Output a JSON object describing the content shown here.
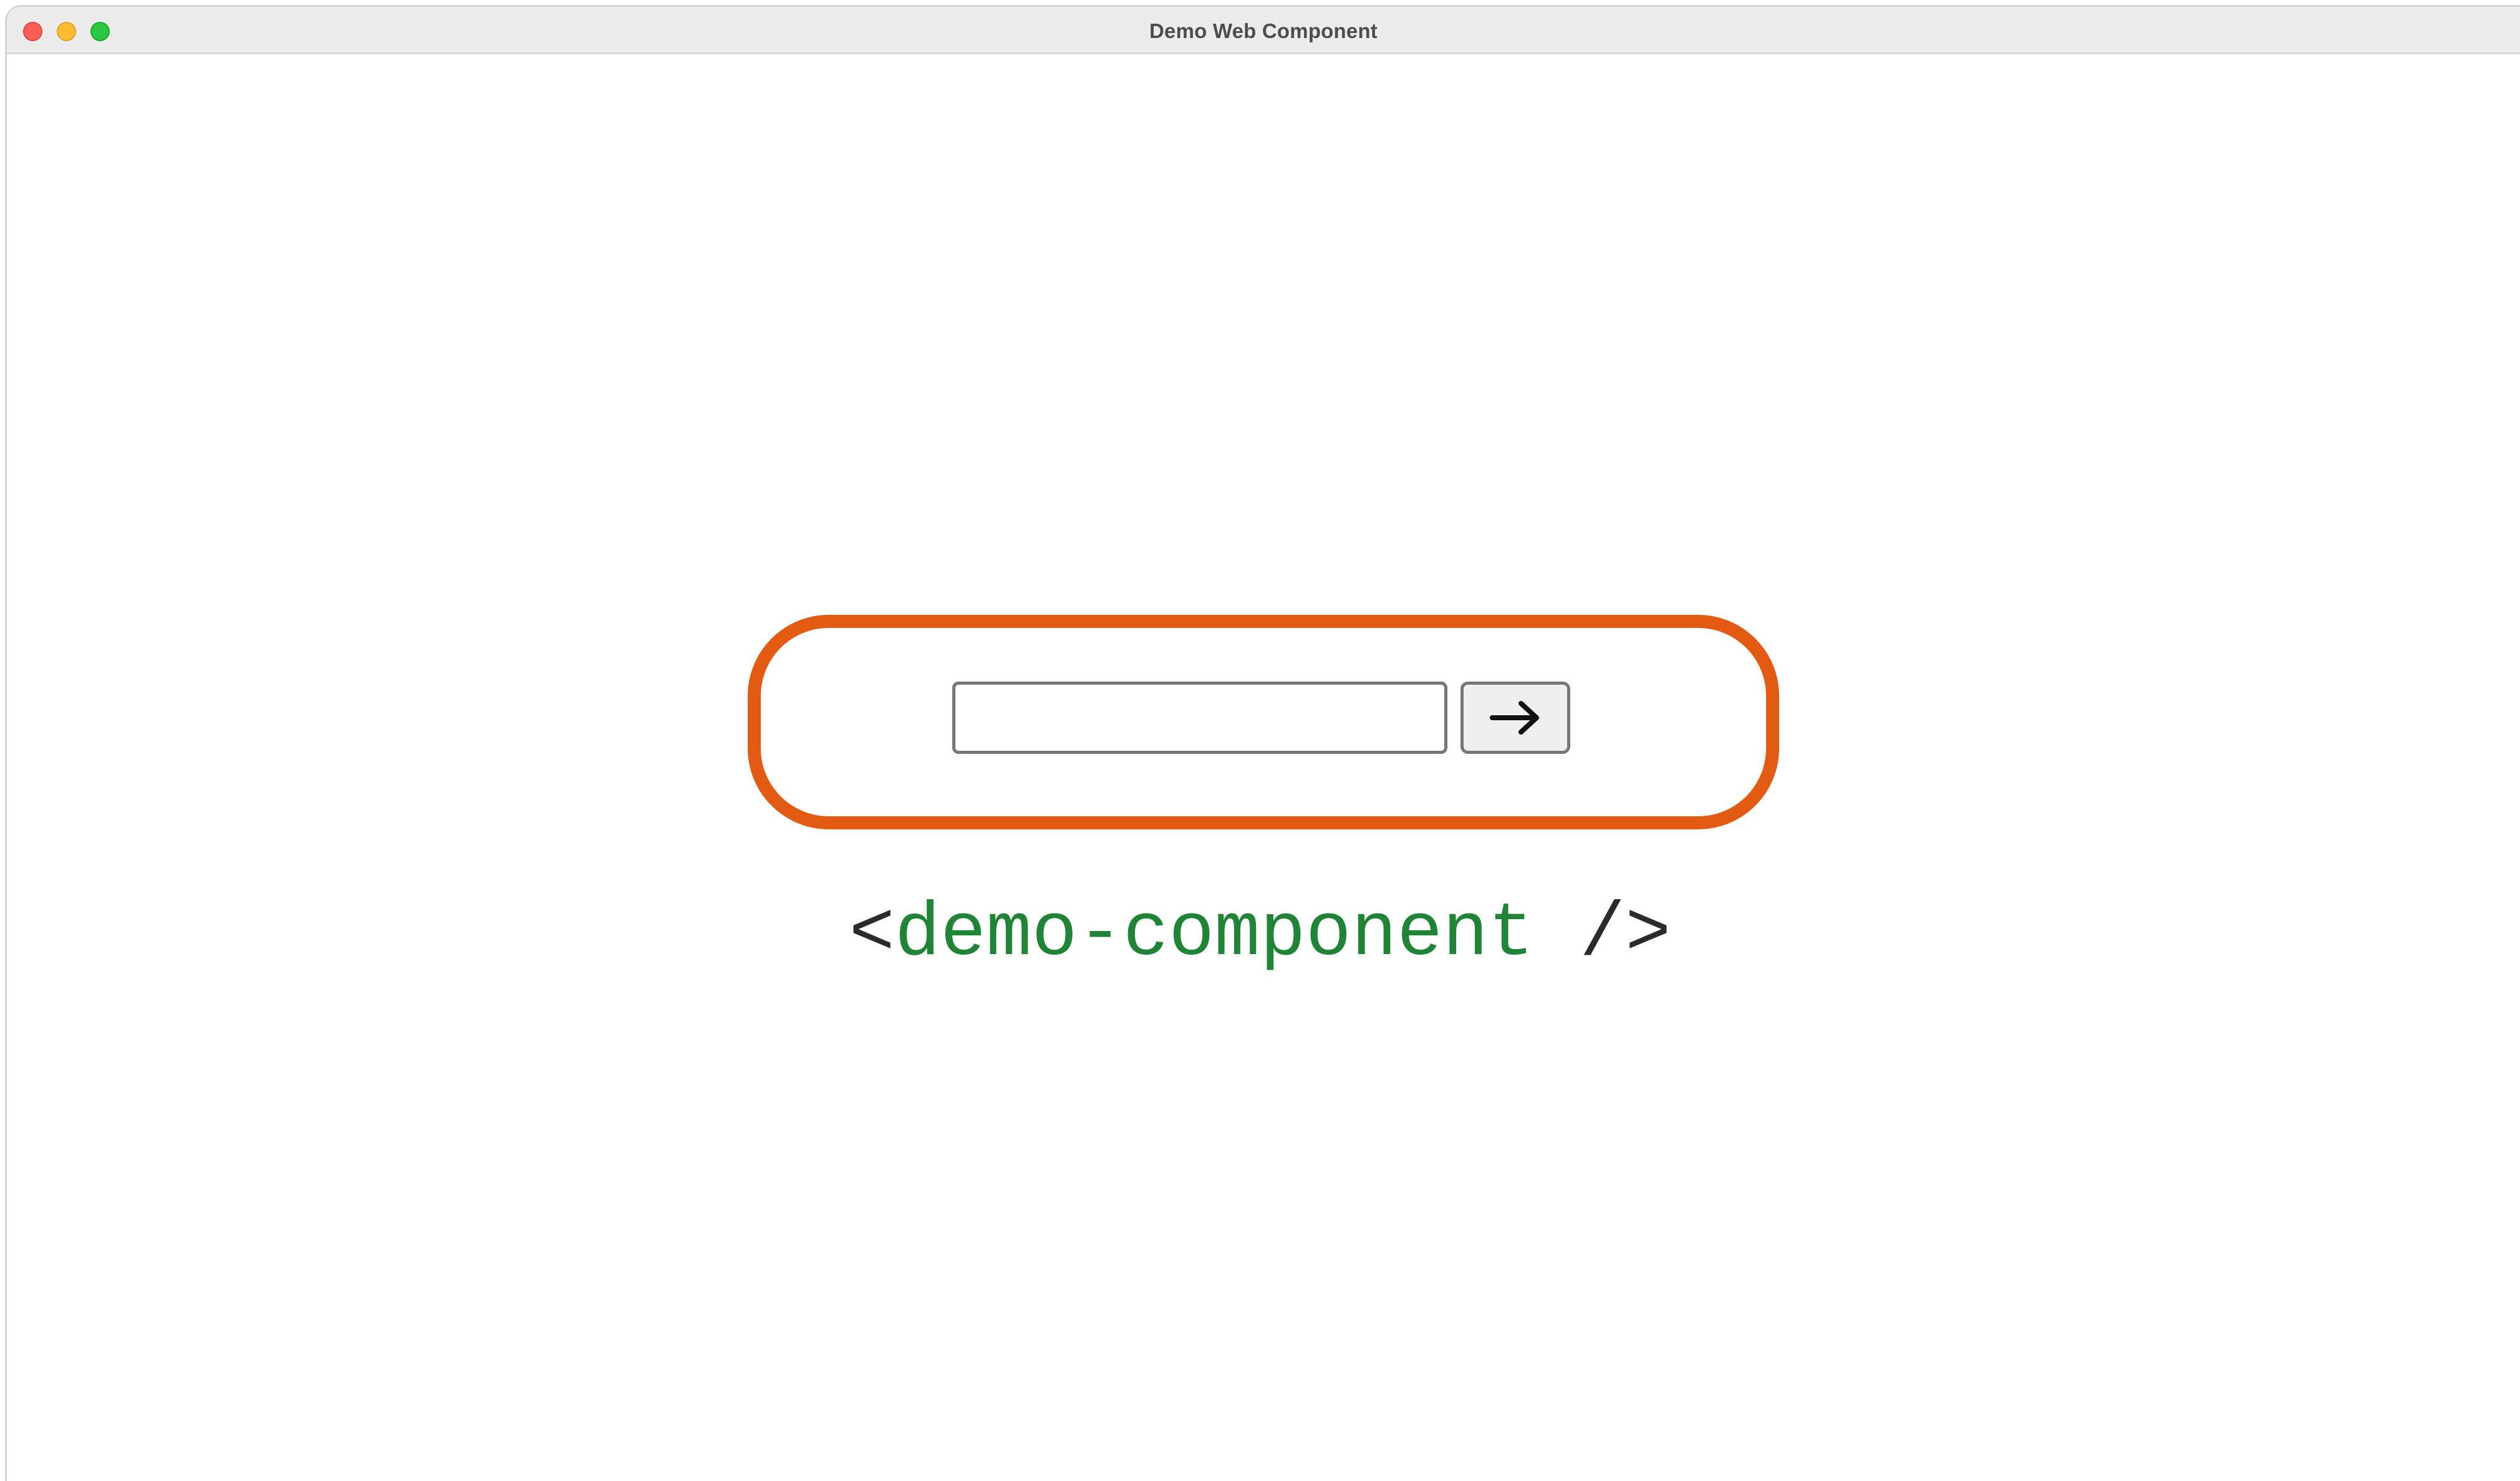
{
  "window": {
    "title": "Demo Web Component"
  },
  "form": {
    "input_value": "",
    "submit_icon": "arrow-right-icon"
  },
  "caption": {
    "open": "<",
    "tag": "demo-component",
    "close": " />"
  },
  "colors": {
    "frame": "#e35a12",
    "tag": "#1f8435",
    "bracket": "#2b2b2b"
  }
}
